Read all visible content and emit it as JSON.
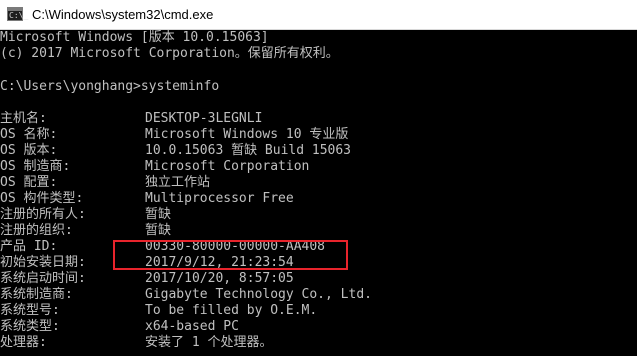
{
  "window": {
    "title": "C:\\Windows\\system32\\cmd.exe",
    "icon": "cmd-prompt-icon"
  },
  "console": {
    "header": [
      "Microsoft Windows [版本 10.0.15063]",
      "(c) 2017 Microsoft Corporation。保留所有权利。"
    ],
    "prompt_line": "C:\\Users\\yonghang>systeminfo",
    "rows": [
      {
        "key": "主机名:",
        "value": "DESKTOP-3LEGNLI"
      },
      {
        "key": "OS 名称:",
        "value": "Microsoft Windows 10 专业版"
      },
      {
        "key": "OS 版本:",
        "value": "10.0.15063 暂缺 Build 15063"
      },
      {
        "key": "OS 制造商:",
        "value": "Microsoft Corporation"
      },
      {
        "key": "OS 配置:",
        "value": "独立工作站"
      },
      {
        "key": "OS 构件类型:",
        "value": "Multiprocessor Free"
      },
      {
        "key": "注册的所有人:",
        "value": "暂缺"
      },
      {
        "key": "注册的组织:",
        "value": "暂缺"
      },
      {
        "key": "产品 ID:",
        "value": "00330-80000-00000-AA408"
      },
      {
        "key": "初始安装日期:",
        "value": "2017/9/12, 21:23:54"
      },
      {
        "key": "系统启动时间:",
        "value": "2017/10/20, 8:57:05"
      },
      {
        "key": "系统制造商:",
        "value": "Gigabyte Technology Co., Ltd."
      },
      {
        "key": "系统型号:",
        "value": "To be filled by O.E.M."
      },
      {
        "key": "系统类型:",
        "value": "x64-based PC"
      },
      {
        "key": "处理器:",
        "value": "安装了 1 个处理器。"
      }
    ]
  },
  "colors": {
    "console_background": "#000000",
    "console_text": "#c0c0c0",
    "highlight_border": "#e8242c"
  }
}
